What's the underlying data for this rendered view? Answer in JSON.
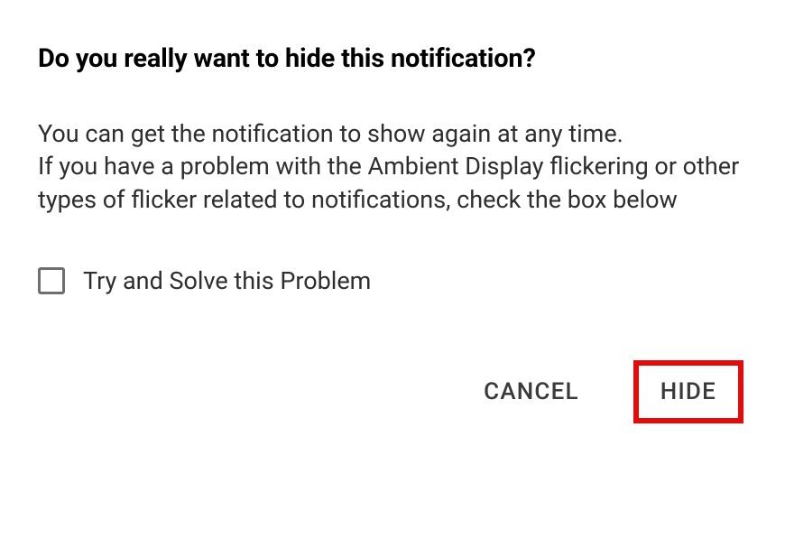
{
  "dialog": {
    "title": "Do you really want to hide this notification?",
    "body": "You can get the notification to show again at any time.\nIf you have a problem with the Ambient Display flickering or other types of flicker related to notifications, check the box below",
    "checkbox_label": "Try and Solve this Problem",
    "cancel_label": "CANCEL",
    "hide_label": "HIDE"
  }
}
